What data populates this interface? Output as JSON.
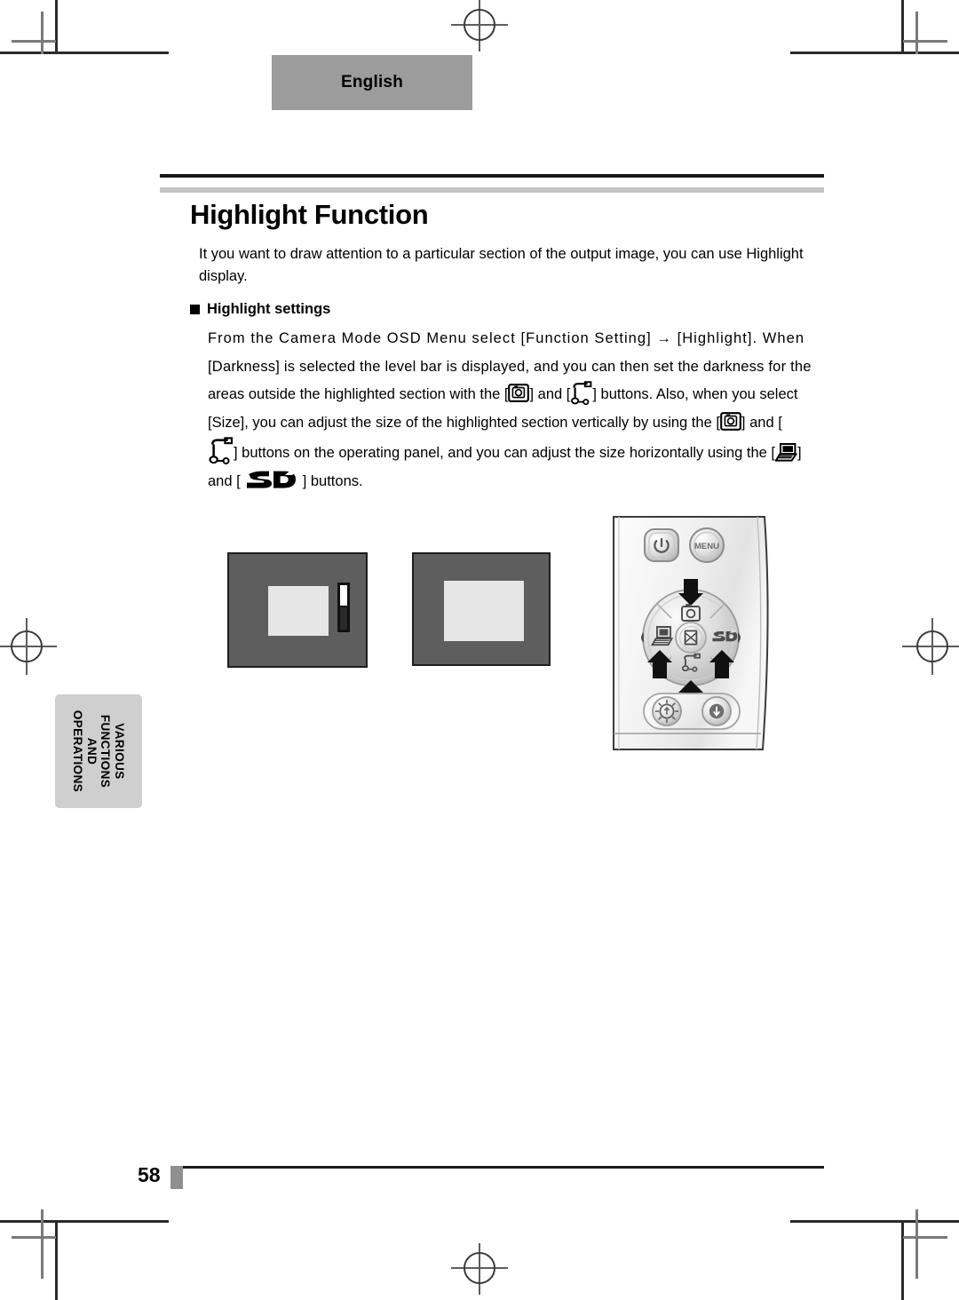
{
  "document": {
    "language_tab": "English",
    "title": "Highlight Function",
    "intro": "It you want to draw attention to a particular section of the output image, you can use Highlight display.",
    "subheading": "Highlight settings",
    "body_lines": [
      "From  the  Camera  Mode  OSD  Menu  select  [Function  Setting]  →  [Highlight].  When",
      "[Darkness] is selected the level bar is displayed, and you can then set the darkness for the",
      "areas outside the highlighted section with the [",
      "] and [",
      "] buttons. Also, when you select",
      "[Size], you can adjust the size of the highlighted section vertically by using the [",
      "] and [",
      "] buttons on the operating panel, and you can adjust the size horizontally using the [",
      "]",
      "and [",
      "] buttons."
    ],
    "body_full_text": "From the Camera Mode OSD Menu select [Function Setting] → [Highlight]. When [Darkness] is selected the level bar is displayed, and you can then set the darkness for the areas outside the highlighted section with the [camera] and [document-camera] buttons. Also, when you select [Size], you can adjust the size of the highlighted section vertically by using the [camera] and [document-camera] buttons on the operating panel, and you can adjust the size horizontally using the [pc] and [sd] buttons.",
    "side_tab_lines": [
      "VARIOUS",
      "FUNCTIONS",
      "AND",
      "OPERATIONS"
    ],
    "page_number": "58"
  },
  "figures": {
    "screen_with_level_bar": {
      "name": "darkness-adjustment-screen",
      "background_color": "#5e5e5e",
      "highlight_color": "#e6e6e6",
      "has_level_bar": true
    },
    "screen_highlight_only": {
      "name": "size-adjustment-screen",
      "background_color": "#5e5e5e",
      "highlight_color": "#e6e6e6",
      "has_level_bar": false
    },
    "operating_panel": {
      "power_button": "power-icon",
      "menu_button": "MENU",
      "dpad_up": "camera-icon",
      "dpad_left": "pc-icon",
      "dpad_right": "sd-icon",
      "dpad_down": "document-camera-icon",
      "dpad_center": "image-rotate-icon",
      "bottom_left_button": "brightness-up-icon",
      "bottom_right_button": "brightness-down-icon",
      "arrow_count": 4
    }
  },
  "print_marks": {
    "corner_marks": 4,
    "registration_marks": 4
  },
  "colors": {
    "lang_tab_bg": "#9c9c9c",
    "side_tab_bg": "#cfcfcf",
    "rule_dark": "#1a1a1a",
    "rule_gray": "#c3c3c3",
    "screen_bg": "#5e5e5e",
    "highlight": "#e6e6e6"
  }
}
